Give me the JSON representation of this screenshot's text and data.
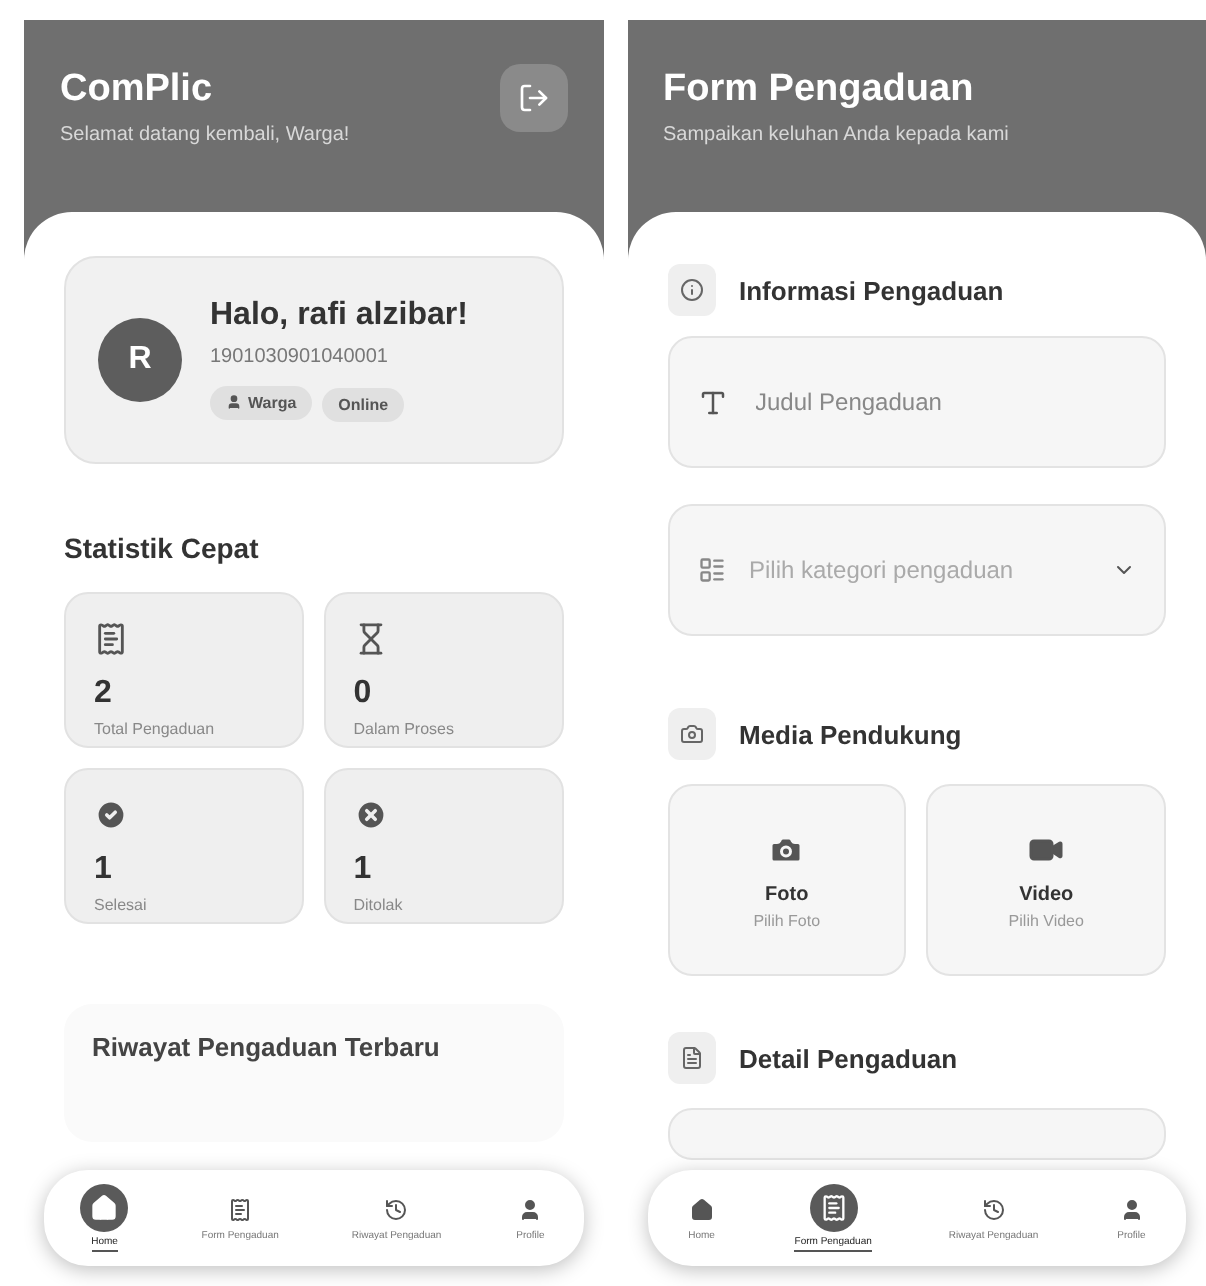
{
  "home_screen": {
    "header": {
      "title": "ComPlic",
      "subtitle": "Selamat datang kembali, Warga!"
    },
    "profile": {
      "initial": "R",
      "greeting": "Halo, rafi alzibar!",
      "id_number": "1901030901040001",
      "role": "Warga",
      "status": "Online"
    },
    "stats_title": "Statistik Cepat",
    "stats": [
      {
        "value": "2",
        "label": "Total Pengaduan"
      },
      {
        "value": "0",
        "label": "Dalam Proses"
      },
      {
        "value": "1",
        "label": "Selesai"
      },
      {
        "value": "1",
        "label": "Ditolak"
      }
    ],
    "recent_title": "Riwayat Pengaduan Terbaru",
    "nav": [
      {
        "label": "Home",
        "selected": true
      },
      {
        "label": "Form Pengaduan",
        "selected": false
      },
      {
        "label": "Riwayat Pengaduan",
        "selected": false
      },
      {
        "label": "Profile",
        "selected": false
      }
    ]
  },
  "form_screen": {
    "header": {
      "title": "Form Pengaduan",
      "subtitle": "Sampaikan keluhan Anda kepada kami"
    },
    "info_section": {
      "title": "Informasi Pengaduan",
      "title_field": {
        "placeholder": "Judul Pengaduan"
      },
      "category_select": {
        "placeholder": "Pilih kategori pengaduan"
      }
    },
    "media_section": {
      "title": "Media Pendukung",
      "options": [
        {
          "title": "Foto",
          "subtitle": "Pilih Foto"
        },
        {
          "title": "Video",
          "subtitle": "Pilih Video"
        }
      ]
    },
    "detail_section": {
      "title": "Detail Pengaduan"
    },
    "nav": [
      {
        "label": "Home",
        "selected": false
      },
      {
        "label": "Form Pengaduan",
        "selected": true
      },
      {
        "label": "Riwayat Pengaduan",
        "selected": false
      },
      {
        "label": "Profile",
        "selected": false
      }
    ]
  }
}
